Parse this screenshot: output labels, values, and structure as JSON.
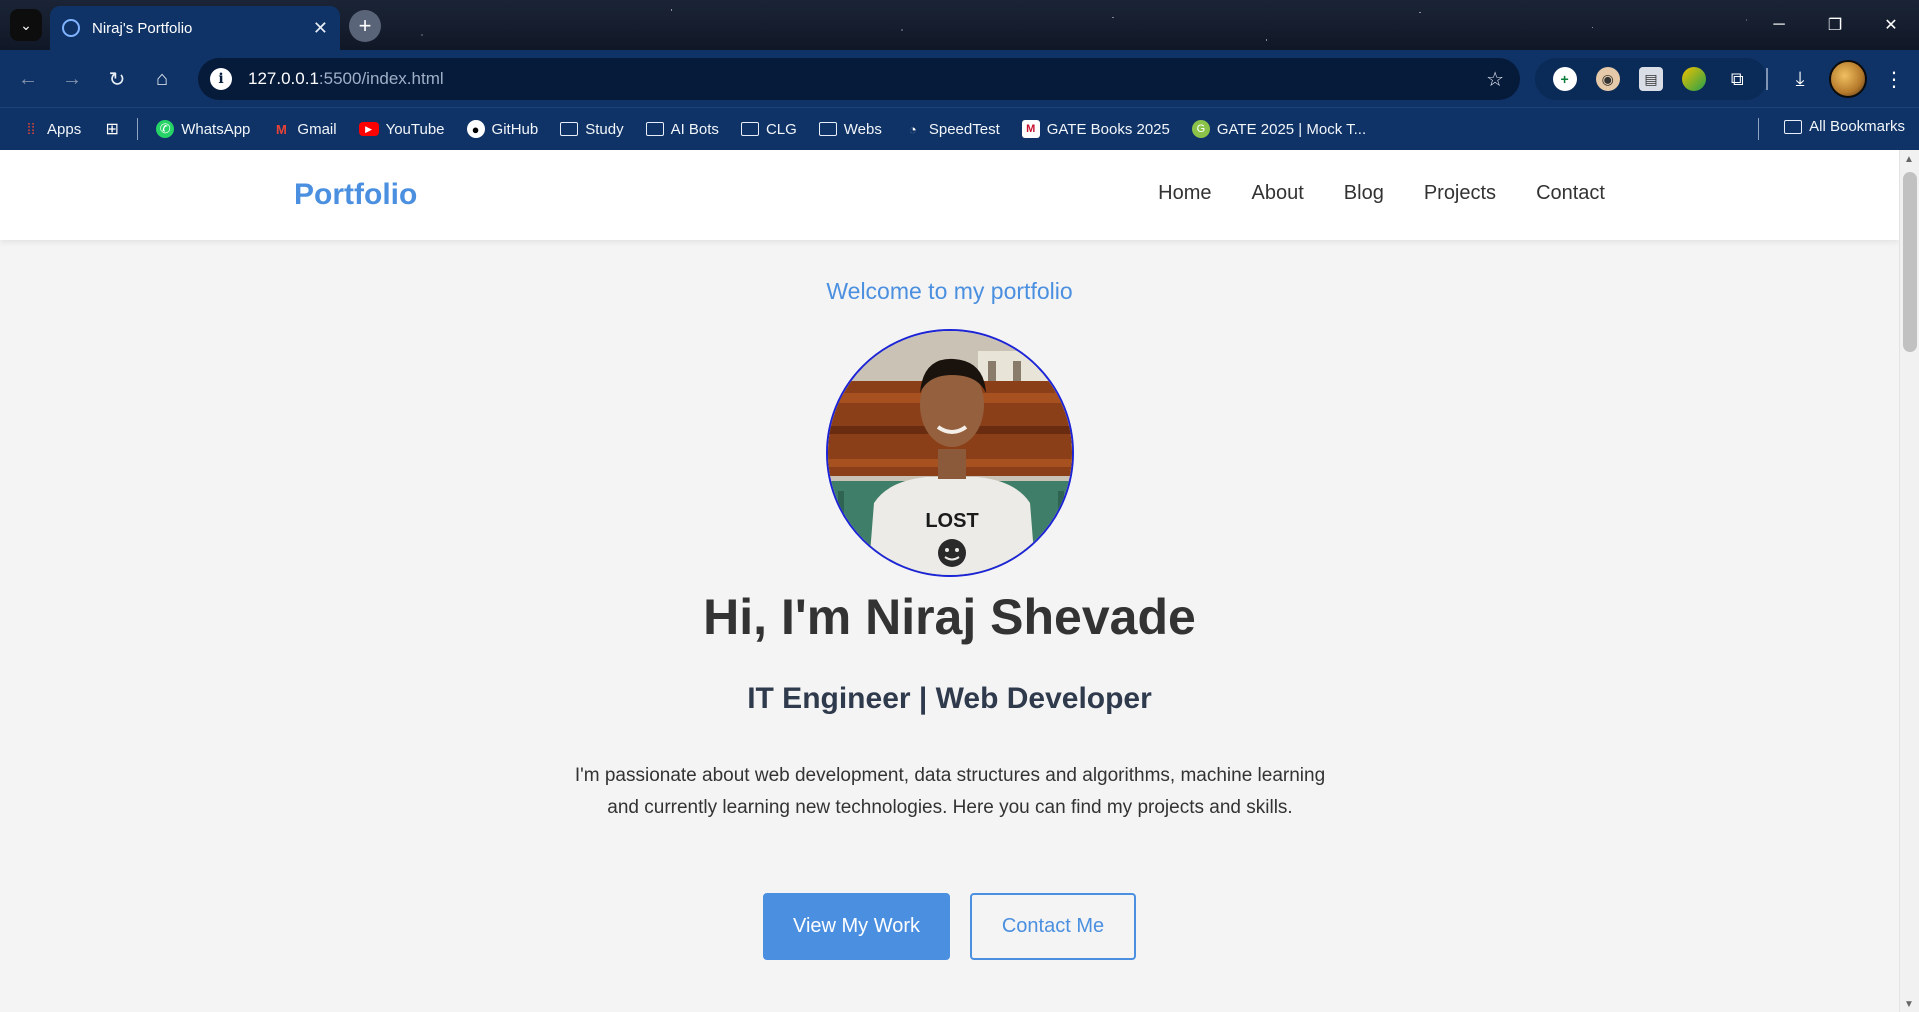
{
  "browser": {
    "tab_title": "Niraj's Portfolio",
    "url_host": "127.0.0.1",
    "url_path": ":5500/index.html",
    "bookmarks": [
      {
        "label": "Apps",
        "icon": "apps-grid-icon"
      },
      {
        "label": "WhatsApp",
        "icon": "whatsapp-icon"
      },
      {
        "label": "Gmail",
        "icon": "gmail-icon"
      },
      {
        "label": "YouTube",
        "icon": "youtube-icon"
      },
      {
        "label": "GitHub",
        "icon": "github-icon"
      },
      {
        "label": "Study",
        "icon": "folder-icon"
      },
      {
        "label": "AI Bots",
        "icon": "folder-icon"
      },
      {
        "label": "CLG",
        "icon": "folder-icon"
      },
      {
        "label": "Webs",
        "icon": "folder-icon"
      },
      {
        "label": "SpeedTest",
        "icon": "speedtest-icon"
      },
      {
        "label": "GATE Books 2025",
        "icon": "gate-books-icon"
      },
      {
        "label": "GATE 2025 | Mock T...",
        "icon": "gate-mock-icon"
      }
    ],
    "all_bookmarks": "All Bookmarks"
  },
  "site": {
    "logo": "Portfolio",
    "nav": [
      "Home",
      "About",
      "Blog",
      "Projects",
      "Contact"
    ],
    "accent_color": "#4a8fe0"
  },
  "hero": {
    "welcome": "Welcome to my portfolio",
    "name": "Hi, I'm Niraj Shevade",
    "role": "IT Engineer | Web Developer",
    "description": "I'm passionate about web development, data structures and algorithms, machine learning and currently learning new technologies. Here you can find my projects and skills.",
    "primary_button": "View My Work",
    "secondary_button": "Contact Me",
    "shirt_text": "LOST"
  }
}
